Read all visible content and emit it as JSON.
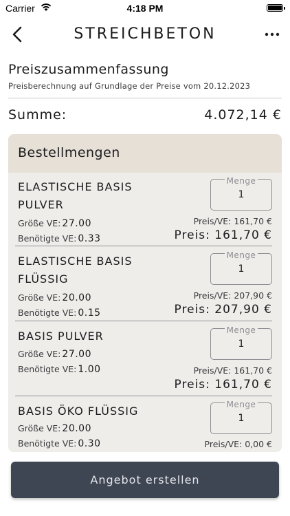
{
  "status_bar": {
    "carrier": "Carrier",
    "time": "4:18 PM"
  },
  "nav": {
    "title": "STREICHBETON"
  },
  "summary": {
    "title": "Preiszusammenfassung",
    "subtitle": "Preisberechnung auf Grundlage der Preise vom 20.12.2023",
    "total_label": "Summe:",
    "total_value": "4.072,14 €"
  },
  "orders": {
    "header": "Bestellmengen",
    "qty_legend": "Menge",
    "size_label": "Größe VE:",
    "needed_label": "Benötigte VE:",
    "items": [
      {
        "name": "ELASTISCHE BASIS PULVER",
        "size": "27.00",
        "needed": "0.33",
        "qty": "1",
        "unit_price": "Preis/VE: 161,70 €",
        "price": "Preis:  161,70 €"
      },
      {
        "name": "ELASTISCHE BASIS FLÜSSIG",
        "size": "20.00",
        "needed": "0.15",
        "qty": "1",
        "unit_price": "Preis/VE: 207,90 €",
        "price": "Preis:  207,90 €"
      },
      {
        "name": "BASIS PULVER",
        "size": "27.00",
        "needed": "1.00",
        "qty": "1",
        "unit_price": "Preis/VE: 161,70 €",
        "price": "Preis:  161,70 €"
      },
      {
        "name": "BASIS ÖKO FLÜSSIG",
        "size": "20.00",
        "needed": "0.30",
        "qty": "1",
        "unit_price": "Preis/VE: 0,00 €",
        "price": ""
      }
    ]
  },
  "cta": {
    "label": "Angebot erstellen"
  },
  "icons": {
    "back": "chevron-left-icon",
    "more": "ellipsis-icon",
    "wifi": "wifi-icon",
    "battery": "battery-icon"
  },
  "colors": {
    "header_bg": "#e6e0d6",
    "card_bg": "#efedea",
    "button_bg": "#3f4653"
  }
}
